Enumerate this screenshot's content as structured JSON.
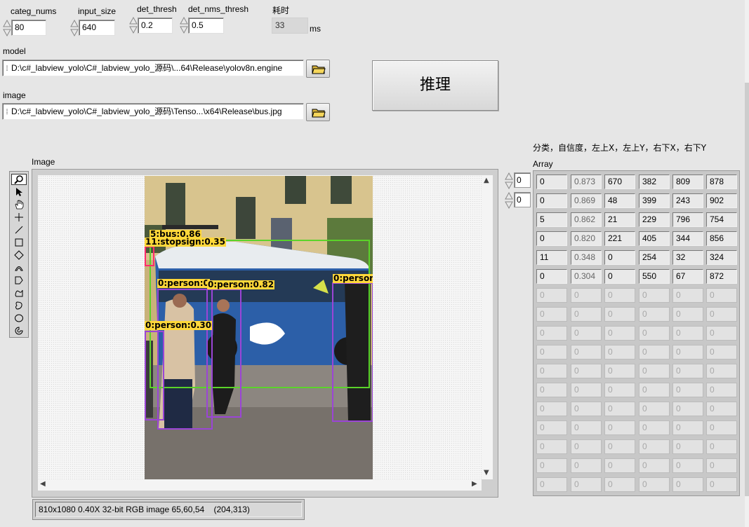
{
  "controls": {
    "categ_nums": {
      "label": "categ_nums",
      "value": "80"
    },
    "input_size": {
      "label": "input_size",
      "value": "640"
    },
    "det_thresh": {
      "label": "det_thresh",
      "value": "0.2"
    },
    "det_nms_thresh": {
      "label": "det_nms_thresh",
      "value": "0.5"
    },
    "time": {
      "label": "耗时",
      "value": "33",
      "unit": "ms"
    }
  },
  "model": {
    "label": "model",
    "path": "D:\\c#_labview_yolo\\C#_labview_yolo_源码\\...64\\Release\\yolov8n.engine"
  },
  "image": {
    "label": "image",
    "path": "D:\\c#_labview_yolo\\C#_labview_yolo_源码\\Tenso...\\x64\\Release\\bus.jpg"
  },
  "infer_button": "推理",
  "display": {
    "label": "Image",
    "status": "810x1080 0.40X 32-bit RGB image 65,60,54    (204,313)",
    "detections": [
      "5:bus:0.86",
      "11:stopsign:0.35",
      "0:person:0",
      "0:person:0.82",
      "0:person",
      "0:person:0.30"
    ]
  },
  "array": {
    "header": "分类，自信度，左上X，左上Y，右下X，右下Y",
    "label": "Array",
    "index": [
      "0",
      "0"
    ],
    "rows": [
      [
        "0",
        "0.873",
        "670",
        "382",
        "809",
        "878"
      ],
      [
        "0",
        "0.869",
        "48",
        "399",
        "243",
        "902"
      ],
      [
        "5",
        "0.862",
        "21",
        "229",
        "796",
        "754"
      ],
      [
        "0",
        "0.820",
        "221",
        "405",
        "344",
        "856"
      ],
      [
        "11",
        "0.348",
        "0",
        "254",
        "32",
        "324"
      ],
      [
        "0",
        "0.304",
        "0",
        "550",
        "67",
        "872"
      ]
    ],
    "empty_value": "0",
    "empty_rows": 11
  },
  "tool_icons": [
    "zoom-icon",
    "pointer-icon",
    "pan-hand-icon",
    "crosshair-icon",
    "line-tool-icon",
    "rectangle-tool-icon",
    "rotated-rect-tool-icon",
    "annulus-arc-tool-icon",
    "polygon-tool-icon",
    "freehand-tool-icon",
    "broken-line-tool-icon",
    "oval-tool-icon",
    "annulus-tool-icon"
  ]
}
